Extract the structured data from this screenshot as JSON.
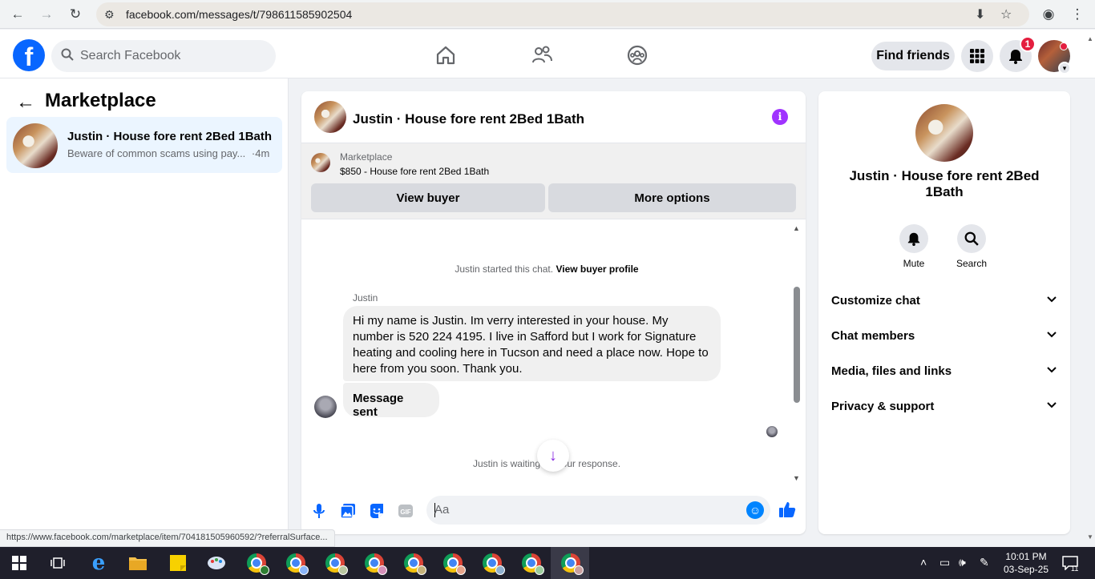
{
  "browser": {
    "url": "facebook.com/messages/t/798611585902504",
    "status_link": "https://www.facebook.com/marketplace/item/704181505960592/?referralSurface..."
  },
  "header": {
    "search_placeholder": "Search Facebook",
    "find_friends": "Find friends",
    "notification_count": "1"
  },
  "sidebar": {
    "title": "Marketplace",
    "conversation": {
      "title": "Justin · House fore rent 2Bed 1Bath",
      "preview": "Beware of common scams using pay...",
      "time": "·4m"
    }
  },
  "chat": {
    "title": "Justin · House fore rent 2Bed 1Bath",
    "listing_label": "Marketplace",
    "listing_price_title": "$850 - House fore rent 2Bed 1Bath",
    "view_buyer": "View buyer",
    "more_options": "More options",
    "started_text": "Justin started this chat.",
    "view_buyer_profile": "View buyer profile",
    "sender": "Justin",
    "message1": "Hi my name is Justin.  Im verry interested in your house.  My number is 520 224 4195. I live in Safford but I work for Signature heating and cooling here in Tucson and need a place now. Hope to here from you soon.  Thank you.",
    "message2": "Message sent",
    "waiting_text": "Justin is waiting for your response.",
    "input_placeholder": "Aa"
  },
  "details": {
    "name": "Justin · House fore rent 2Bed 1Bath",
    "mute": "Mute",
    "search": "Search",
    "rows": [
      "Customize chat",
      "Chat members",
      "Media, files and links",
      "Privacy & support"
    ]
  },
  "taskbar": {
    "time": "10:01 PM",
    "date": "03-Sep-25",
    "notif_count": "11"
  },
  "colors": {
    "accent_blue": "#0866ff",
    "messenger_purple": "#a033ff",
    "selected_bg": "#ebf5ff"
  }
}
